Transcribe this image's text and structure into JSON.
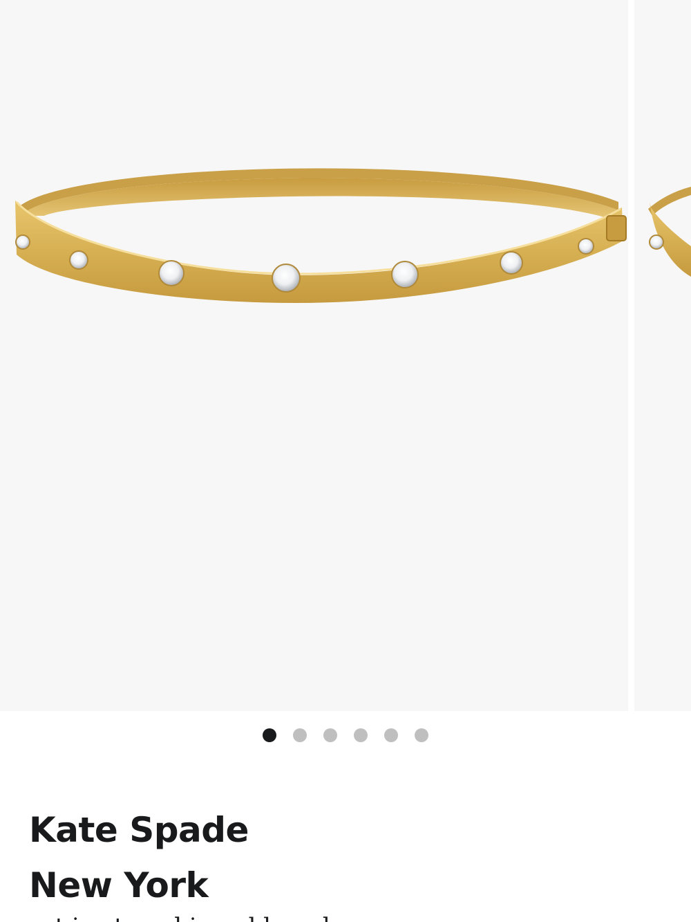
{
  "product": {
    "brand": "Kate Spade New York",
    "brand_lines": [
      "Kate Spade",
      "New York"
    ],
    "image_alt": "gold bangle with crystals",
    "name_partial": "set in stone hinged bangle"
  },
  "carousel": {
    "slide_count": 6,
    "current_index": 0,
    "dot_labels": [
      "Image 1",
      "Image 2",
      "Image 3",
      "Image 4",
      "Image 5",
      "Image 6"
    ]
  },
  "colors": {
    "slide_background": "#f7f7f7",
    "gold": "#d9b256",
    "gold_dark": "#b88a2c",
    "text": "#191a1b",
    "dot_active": "#191a1b",
    "dot_inactive": "#bfbfbf"
  }
}
